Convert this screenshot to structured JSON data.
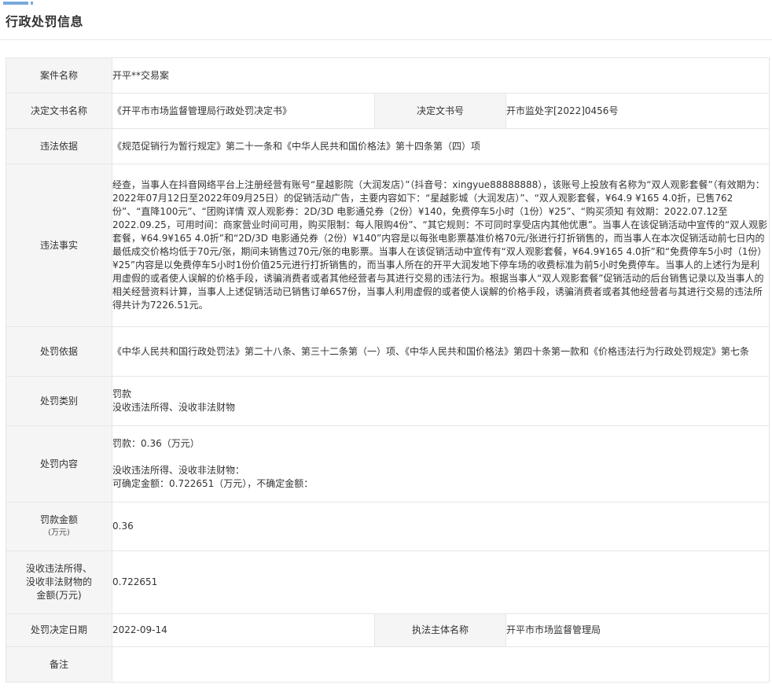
{
  "page_title": "行政处罚信息",
  "colors": {
    "accent": "#7aa9dc",
    "label_bg": "#f5f5f5",
    "border": "#e6e6e6",
    "text": "#333333"
  },
  "rows": {
    "case_name": {
      "label": "案件名称",
      "value": "开平**交易案"
    },
    "decision_doc": {
      "name_label": "决定文书名称",
      "name_value": "《开平市市场监督管理局行政处罚决定书》",
      "number_label": "决定文书号",
      "number_value": "开市监处字[2022]0456号"
    },
    "legal_basis": {
      "label": "违法依据",
      "value": "《规范促销行为暂行规定》第二十一条和《中华人民共和国价格法》第十四条第（四）项"
    },
    "illegal_facts": {
      "label": "违法事实",
      "value": "经查，当事人在抖音网络平台上注册经营有账号“星越影院（大润发店）”（抖音号：xingyue88888888），该账号上投放有名称为“双人观影套餐”（有效期为：2022年07月12日至2022年09月25日）的促销活动广告，主要内容如下：“星越影城（大润发店）”、“双人观影套餐，¥64.9 ¥165 4.0折，已售762份”、“直降100元”、“团购详情 双人观影券：2D/3D 电影通兑券（2份）¥140，免费停车5小时（1份）¥25”、“购买须知 有效期：2022.07.12至2022.09.25，可用时间：商家营业时间可用，购买限制：每人限购4份”、“其它规则：不可同时享受店内其他优惠”。当事人在该促销活动中宣传的“双人观影套餐，¥64.9¥165 4.0折”和“2D/3D 电影通兑券（2份）¥140”内容是以每张电影票基准价格70元/张进行打折销售的，而当事人在本次促销活动前七日内的最低成交价格均低于70元/张，期间未销售过70元/张的电影票。当事人在该促销活动中宣传有“双人观影套餐，¥64.9¥165 4.0折”和“免费停车5小时（1份）¥25”内容是以免费停车5小时1份价值25元进行打折销售的，而当事人所在的开平大润发地下停车场的收费标准为前5小时免费停车。当事人的上述行为是利用虚假的或者使人误解的价格手段，诱骗消费者或者其他经营者与其进行交易的违法行为。根据当事人“双人观影套餐”促销活动的后台销售记录以及当事人的相关经营资料计算，当事人上述促销活动已销售订单657份，当事人利用虚假的或者使人误解的价格手段，诱骗消费者或者其他经营者与其进行交易的违法所得共计为7226.51元。"
    },
    "penalty_basis": {
      "label": "处罚依据",
      "value": "《中华人民共和国行政处罚法》第二十八条、第三十二条第（一）项、《中华人民共和国价格法》第四十条第一款和《价格违法行为行政处罚规定》第七条"
    },
    "penalty_type": {
      "label": "处罚类别",
      "line1": "罚款",
      "line2": "没收违法所得、没收非法财物"
    },
    "penalty_content": {
      "label": "处罚内容",
      "line1": "罚款：0.36（万元）",
      "line2": "没收违法所得、没收非法财物：",
      "line3": "可确定金额：0.722651（万元），不确定金额："
    },
    "fine_amount": {
      "label": "罚款金额",
      "sublabel": "(万元)",
      "value": "0.36"
    },
    "confiscation_amount": {
      "label": "没收违法所得、\n没收非法财物的\n金额(万元)",
      "value": "0.722651"
    },
    "decision_date": {
      "date_label": "处罚决定日期",
      "date_value": "2022-09-14",
      "authority_label": "执法主体名称",
      "authority_value": "开平市市场监督管理局"
    },
    "remarks": {
      "label": "备注",
      "value": ""
    }
  }
}
